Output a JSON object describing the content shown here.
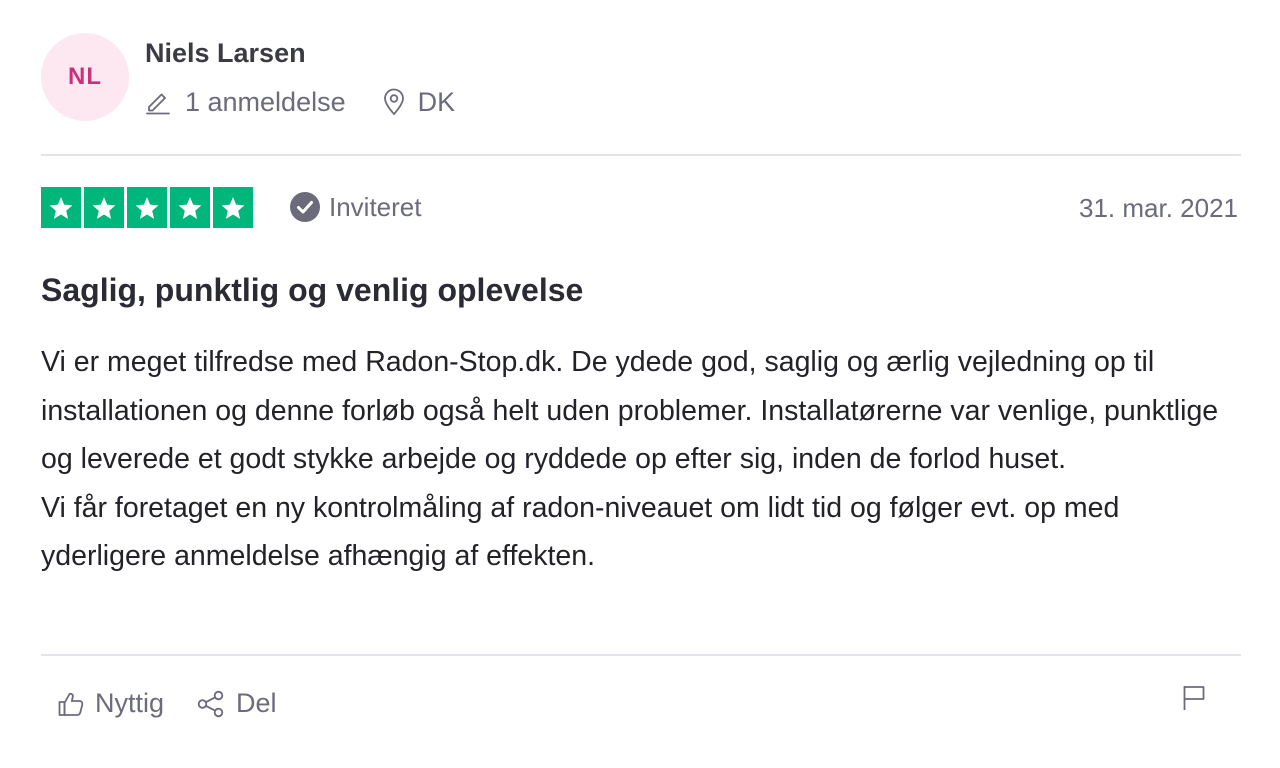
{
  "author": {
    "initials": "NL",
    "name": "Niels Larsen",
    "review_count": "1 anmeldelse",
    "country": "DK",
    "avatar_bg": "#fde8f1",
    "avatar_fg": "#c8327a"
  },
  "rating": {
    "stars": 5,
    "max_stars": 5,
    "star_color": "#00b67a",
    "badge_icon": "verified-check-icon",
    "badge_label": "Inviteret",
    "date": "31. mar. 2021"
  },
  "review": {
    "title": "Saglig, punktlig og venlig oplevelse",
    "paragraphs": [
      "Vi er meget tilfredse med Radon-Stop.dk. De ydede god, saglig og ærlig vejledning op til installationen og denne forløb også helt uden problemer. Installatørerne var venlige, punktlige og leverede et godt stykke arbejde og ryddede op efter sig, inden de forlod huset.",
      "Vi får foretaget en ny kontrolmåling af radon-niveauet om lidt tid og følger evt. op med yderligere anmeldelse afhængig af effekten."
    ]
  },
  "actions": {
    "useful_label": "Nyttig",
    "useful_icon": "thumbs-up-icon",
    "share_label": "Del",
    "share_icon": "share-icon",
    "report_icon": "flag-icon"
  }
}
